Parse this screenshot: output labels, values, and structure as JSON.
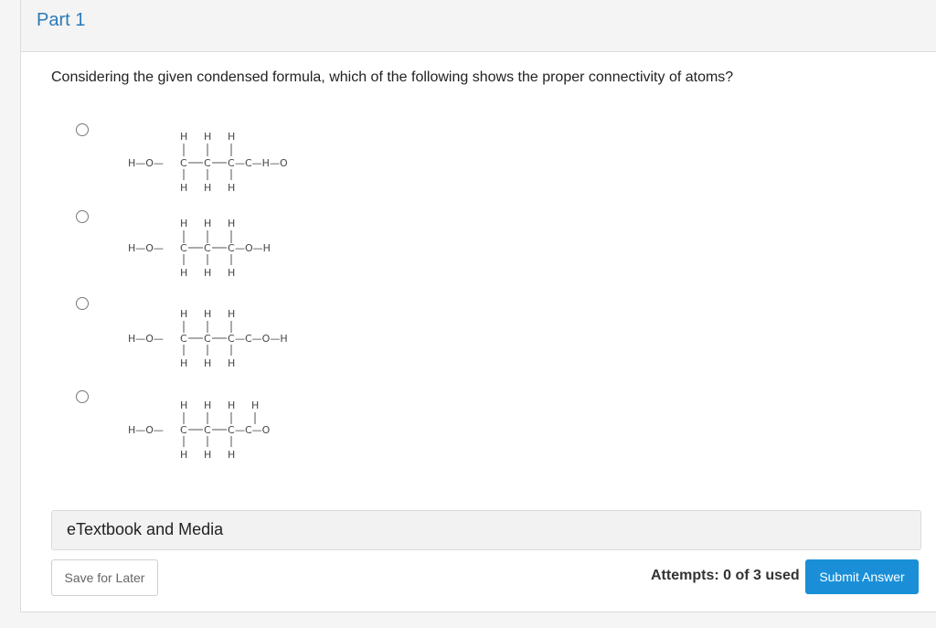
{
  "part": {
    "title": "Part 1"
  },
  "question": {
    "text": "Considering the given condensed formula, which of the following shows the proper connectivity of atoms?"
  },
  "options": [
    {
      "tail": "—C—H—O"
    },
    {
      "tail": "—O—H"
    },
    {
      "tail": "—C—O—H"
    },
    {
      "tail": "—C—O"
    }
  ],
  "atoms": {
    "h": "H",
    "c": "C",
    "ho": "H—O—"
  },
  "etextbook": {
    "label": "eTextbook and Media"
  },
  "footer": {
    "save_label": "Save for Later",
    "attempts": "Attempts: 0 of 3 used",
    "submit_label": "Submit Answer"
  },
  "colors": {
    "title_blue": "#2a7ab8",
    "submit_blue": "#1a8fd8"
  }
}
